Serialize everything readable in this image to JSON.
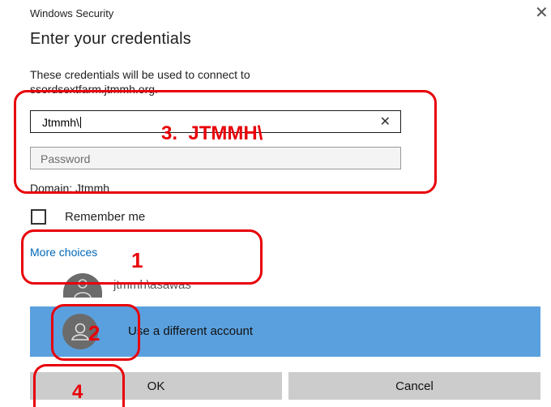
{
  "window": {
    "title": "Windows Security",
    "close_icon": "close-icon"
  },
  "dialog": {
    "heading": "Enter your credentials",
    "description_line1": "These credentials will be used to connect to",
    "description_line2": "ssordsextfarm.jtmmh.org.",
    "username_value": "Jtmmh\\",
    "password_placeholder": "Password",
    "domain_label": "Domain: Jtmmh",
    "remember_label": "Remember me",
    "remember_checked": false,
    "more_choices": "More choices",
    "accounts": [
      {
        "name": "jtmmh\\asawas",
        "icon": "user-avatar-icon"
      },
      {
        "name": "Use a different account",
        "icon": "user-avatar-icon",
        "selected": true
      }
    ],
    "ok_label": "OK",
    "cancel_label": "Cancel"
  },
  "annotations": {
    "color": "#e8000a",
    "step1": "1",
    "step2": "2",
    "step3": "3.  JTMMH\\",
    "step4": "4"
  },
  "colors": {
    "selected_row": "#5aa0de",
    "link": "#0067b8",
    "button": "#cccccc"
  }
}
